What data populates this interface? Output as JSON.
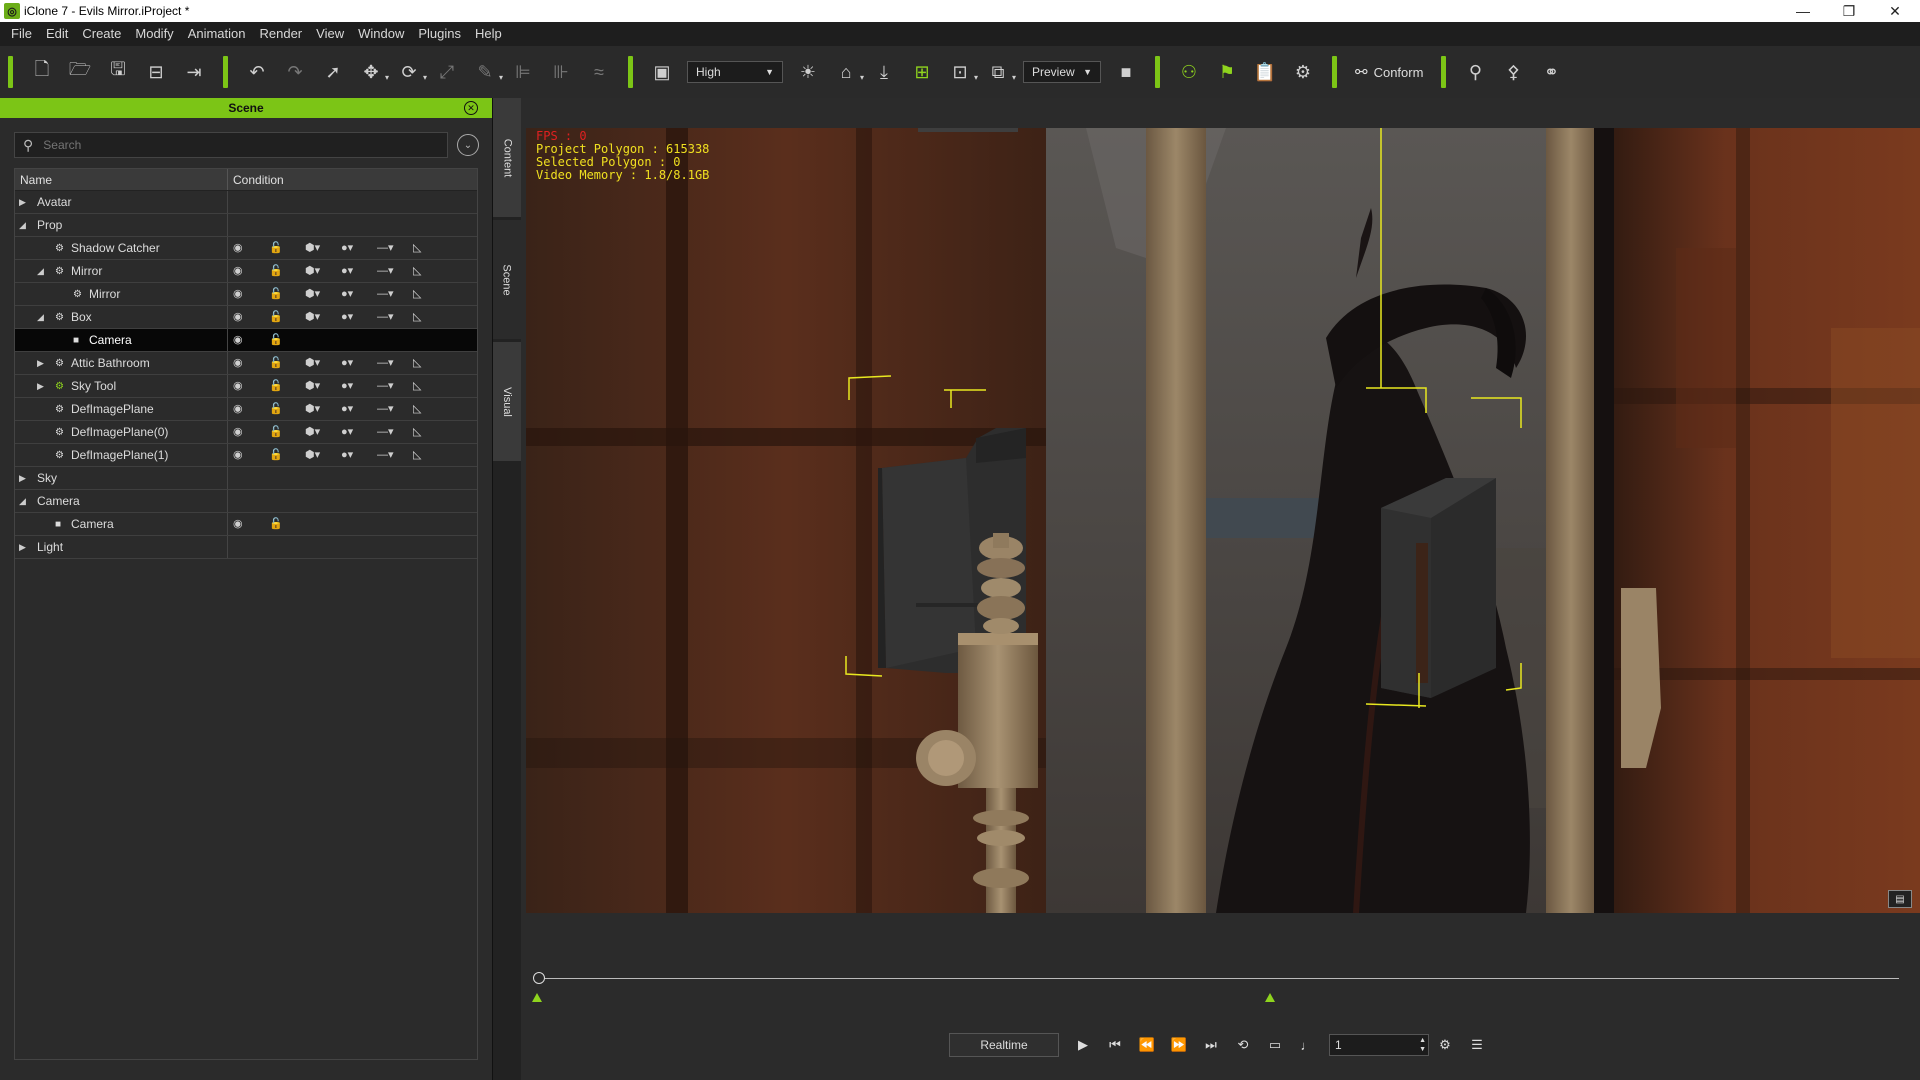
{
  "window": {
    "title": "iClone 7 - Evils Mirror.iProject *",
    "controls": [
      "—",
      "❐",
      "✕"
    ]
  },
  "menu": [
    "File",
    "Edit",
    "Create",
    "Modify",
    "Animation",
    "Render",
    "View",
    "Window",
    "Plugins",
    "Help"
  ],
  "toolbar": {
    "quality_select": "High",
    "preview_select": "Preview",
    "conform_label": "Conform"
  },
  "scene_panel": {
    "title": "Scene",
    "search_placeholder": "Search",
    "col_name": "Name",
    "col_condition": "Condition",
    "rows": [
      {
        "label": "Avatar",
        "level": 0,
        "twisty": "collapsed",
        "icon": "",
        "cond": false
      },
      {
        "label": "Prop",
        "level": 0,
        "twisty": "expanded",
        "icon": "",
        "cond": false
      },
      {
        "label": "Shadow Catcher",
        "level": 1,
        "twisty": "none",
        "icon": "prop",
        "cond": "full"
      },
      {
        "label": "Mirror",
        "level": 1,
        "twisty": "expanded",
        "icon": "prop",
        "cond": "full"
      },
      {
        "label": "Mirror",
        "level": 2,
        "twisty": "none",
        "icon": "prop",
        "cond": "full"
      },
      {
        "label": "Box",
        "level": 1,
        "twisty": "expanded",
        "icon": "prop",
        "cond": "full"
      },
      {
        "label": "Camera",
        "level": 2,
        "twisty": "none",
        "icon": "camera",
        "cond": "short",
        "selected": true
      },
      {
        "label": "Attic Bathroom",
        "level": 1,
        "twisty": "collapsed",
        "icon": "prop",
        "cond": "full"
      },
      {
        "label": "Sky Tool",
        "level": 1,
        "twisty": "collapsed",
        "icon": "prop-green",
        "cond": "full"
      },
      {
        "label": "DefImagePlane",
        "level": 1,
        "twisty": "none",
        "icon": "prop",
        "cond": "full"
      },
      {
        "label": "DefImagePlane(0)",
        "level": 1,
        "twisty": "none",
        "icon": "prop",
        "cond": "full"
      },
      {
        "label": "DefImagePlane(1)",
        "level": 1,
        "twisty": "none",
        "icon": "prop",
        "cond": "full"
      },
      {
        "label": "Sky",
        "level": 0,
        "twisty": "collapsed",
        "icon": "",
        "cond": false
      },
      {
        "label": "Camera",
        "level": 0,
        "twisty": "expanded",
        "icon": "",
        "cond": false
      },
      {
        "label": "Camera",
        "level": 1,
        "twisty": "none",
        "icon": "camera",
        "cond": "short"
      },
      {
        "label": "Light",
        "level": 0,
        "twisty": "collapsed",
        "icon": "",
        "cond": false
      }
    ]
  },
  "side_tabs": [
    "Content",
    "Scene",
    "Visual"
  ],
  "viewport": {
    "fps": "FPS : 0",
    "project_polygon": "Project Polygon : 615338",
    "selected_polygon": "Selected Polygon : 0",
    "video_memory": "Video Memory : 1.8/8.1GB"
  },
  "playback": {
    "mode": "Realtime",
    "frame": "1"
  },
  "colors": {
    "accent": "#7cc516",
    "stats_text": "#f0e020",
    "fps_text": "#e02020"
  }
}
